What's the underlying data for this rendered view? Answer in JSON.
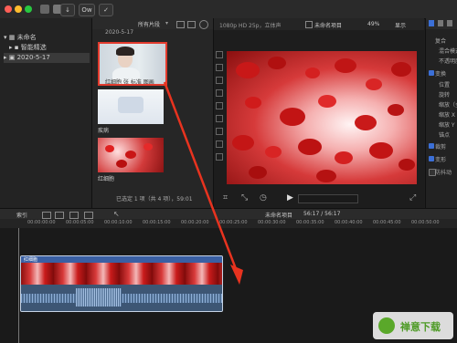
{
  "toolbar": {
    "keyword_label": "Ow"
  },
  "library": {
    "items": [
      {
        "label": "未命名"
      },
      {
        "label": "智能精选"
      },
      {
        "label": "2020-5-17"
      }
    ]
  },
  "browser": {
    "filter_label": "所有片段",
    "date_header": "2020-5-17",
    "clips": [
      {
        "name": "红细胞 张 标准 图画"
      },
      {
        "name": "疾病"
      },
      {
        "name": "红细胞"
      }
    ],
    "status": "已选定 1 项（共 4 项），59:01"
  },
  "viewer": {
    "format": "1080p HD 25p，立体声",
    "project": "未命名项目",
    "zoom": "49%",
    "display": "显示"
  },
  "inspector": {
    "rows": [
      "复合",
      "混合模式",
      "不透明度",
      "变换",
      "位置",
      "旋转",
      "缩放（全部）",
      "缩放 X",
      "缩放 Y",
      "锚点",
      "裁剪",
      "变形",
      "防抖动"
    ]
  },
  "timeline_bar": {
    "index_label": "索引",
    "project_name": "未命名项目",
    "duration": "56:17 / 56:17"
  },
  "ruler_ticks": [
    "00:00:00:00",
    "00:00:05:00",
    "00:00:10:00",
    "00:00:15:00",
    "00:00:20:00",
    "00:00:25:00",
    "00:00:30:00",
    "00:00:35:00",
    "00:00:40:00",
    "00:00:45:00",
    "00:00:50:00"
  ],
  "timeline": {
    "clip_name": "红细胞"
  },
  "watermark": {
    "text": "禅意下载"
  }
}
